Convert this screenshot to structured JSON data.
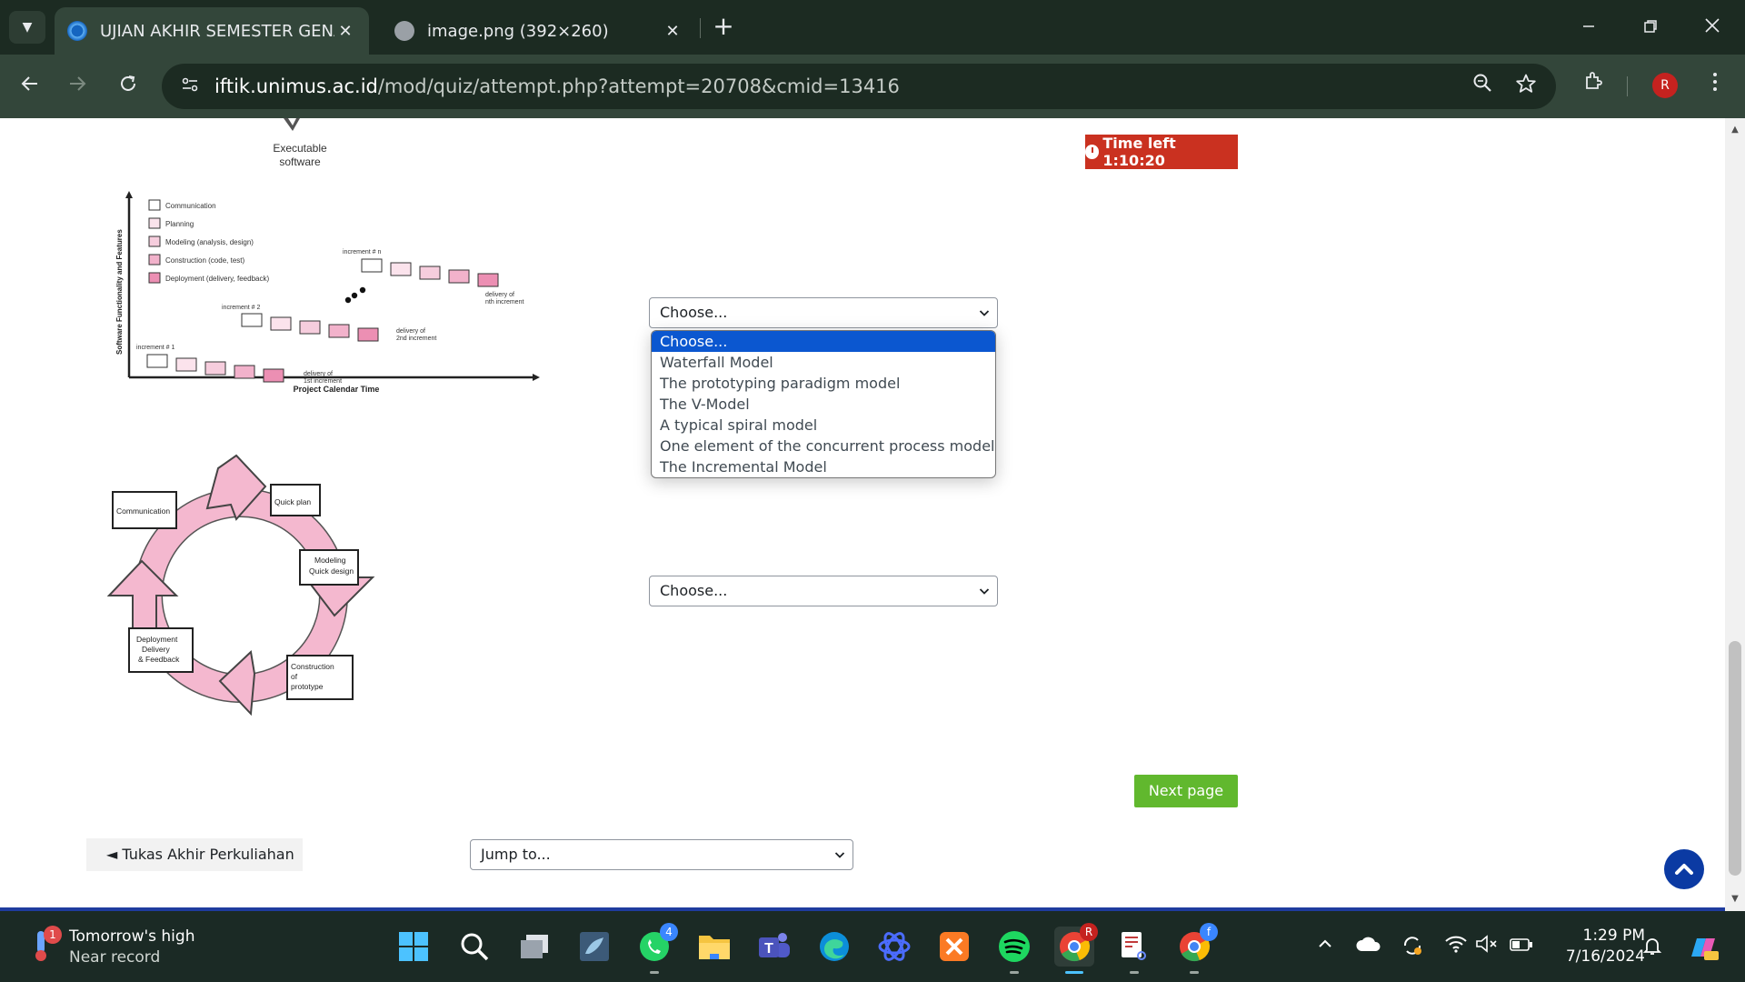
{
  "browser": {
    "tabs": [
      {
        "title": "UJIAN AKHIR SEMESTER GENAP",
        "close": "✕"
      },
      {
        "title": "image.png (392×260)",
        "close": "✕"
      }
    ],
    "new_tab": "+",
    "url_host": "iftik.unimus.ac.id",
    "url_path": "/mod/quiz/attempt.php?attempt=20708&cmid=13416",
    "profile_initial": "R"
  },
  "quiz": {
    "timer_label": "Time left 1:10:20",
    "select1_value": "Choose...",
    "select2_value": "Choose...",
    "options": [
      "Choose...",
      "Waterfall Model",
      "The prototyping paradigm model",
      "The V-Model",
      "A typical spiral model",
      "One element of the concurrent process model",
      "The Incremental Model"
    ],
    "next_label": "Next page",
    "prev_label": "◄ Tukas Akhir Perkuliahan",
    "jump_value": "Jump to..."
  },
  "diagram_exec": {
    "label_line1": "Executable",
    "label_line2": "software"
  },
  "diagram_incremental": {
    "legend": [
      "Communication",
      "Planning",
      "Modeling (analysis, design)",
      "Construction (code, test)",
      "Deployment (delivery, feedback)"
    ],
    "y_axis": "Software Functionality and Features",
    "x_axis": "Project Calendar Time",
    "inc1": "increment # 1",
    "inc2": "increment # 2",
    "incn": "increment # n",
    "del1a": "delivery of",
    "del1b": "1st increment",
    "del2a": "delivery of",
    "del2b": "2nd increment",
    "delna": "delivery of",
    "delnb": "nth increment"
  },
  "diagram_prototype": {
    "communication": "Communication",
    "quick_plan": "Quick plan",
    "modeling1": "Modeling",
    "modeling2": "Quick design",
    "construction1": "Construction",
    "construction2": "of",
    "construction3": "prototype",
    "deploy1": "Deployment",
    "deploy2": "Delivery",
    "deploy3": "& Feedback"
  },
  "taskbar": {
    "weather_line1": "Tomorrow's high",
    "weather_line2": "Near record",
    "weather_badge": "1",
    "whatsapp_badge": "4",
    "chrome_badge": "R",
    "chrome2_badge": "f",
    "time": "1:29 PM",
    "date": "7/16/2024"
  },
  "colors": {
    "tabstrip": "#1c2b22",
    "toolbar": "#33463a",
    "timer": "#ca3120",
    "next_button": "#61b82e",
    "dropdown_highlight": "#0b57d0",
    "diagram_pink": "#f4b8cf"
  }
}
